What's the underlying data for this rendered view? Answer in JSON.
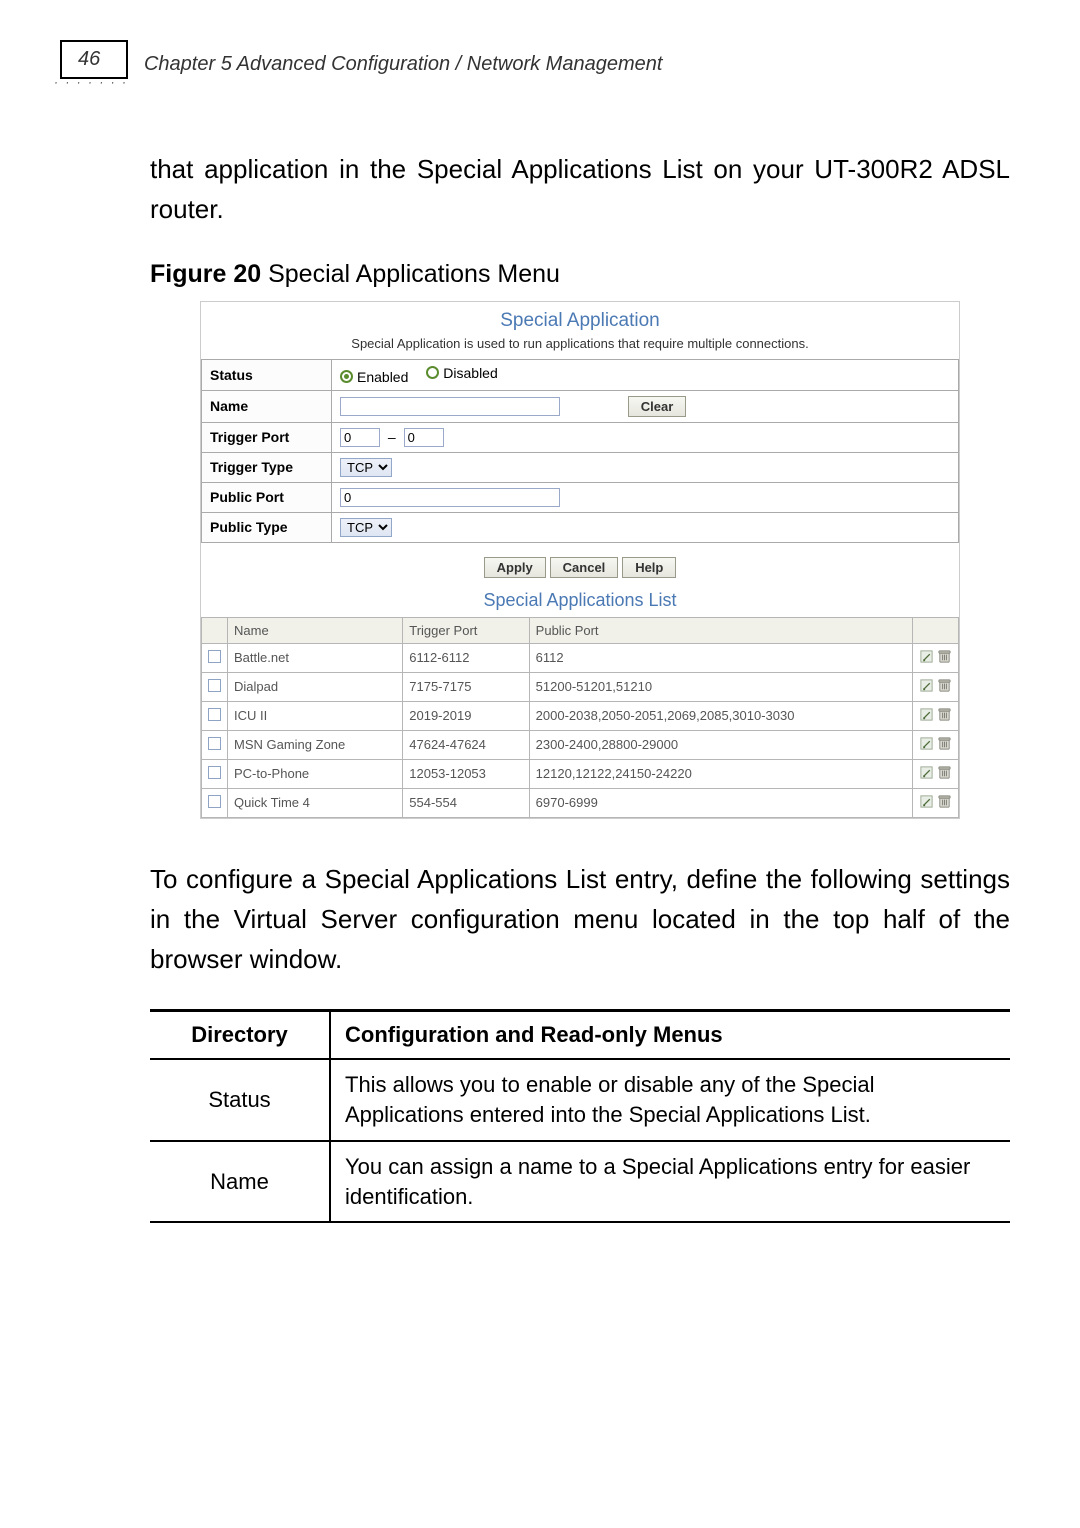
{
  "page_number": "46",
  "chapter_title": "Chapter 5 Advanced Configuration / Network Management",
  "intro_para": "that application in the Special Applications List on your UT-300R2 ADSL router.",
  "figure_label": "Figure 20",
  "figure_caption": " Special Applications Menu",
  "sa": {
    "title": "Special Application",
    "subtitle": "Special Application is used to run applications that require multiple connections.",
    "labels": {
      "status": "Status",
      "name": "Name",
      "trigger_port": "Trigger Port",
      "trigger_type": "Trigger Type",
      "public_port": "Public Port",
      "public_type": "Public Type"
    },
    "enabled": "Enabled",
    "disabled": "Disabled",
    "clear": "Clear",
    "tp_from": "0",
    "tp_to": "0",
    "dash": "–",
    "trigger_type_val": "TCP",
    "public_port_val": "0",
    "public_type_val": "TCP",
    "apply": "Apply",
    "cancel": "Cancel",
    "help": "Help"
  },
  "list": {
    "title": "Special Applications List",
    "headers": {
      "name": "Name",
      "trigger": "Trigger Port",
      "public": "Public Port"
    },
    "rows": [
      {
        "name": "Battle.net",
        "trigger": "6112-6112",
        "public": "6112"
      },
      {
        "name": "Dialpad",
        "trigger": "7175-7175",
        "public": "51200-51201,51210"
      },
      {
        "name": "ICU II",
        "trigger": "2019-2019",
        "public": "2000-2038,2050-2051,2069,2085,3010-3030"
      },
      {
        "name": "MSN Gaming Zone",
        "trigger": "47624-47624",
        "public": "2300-2400,28800-29000"
      },
      {
        "name": "PC-to-Phone",
        "trigger": "12053-12053",
        "public": "12120,12122,24150-24220"
      },
      {
        "name": "Quick Time 4",
        "trigger": "554-554",
        "public": "6970-6999"
      }
    ]
  },
  "config_para": "To configure a Special Applications List entry, define the following settings in the Virtual Server configuration menu located in the top half of the browser window.",
  "dir_headers": {
    "dir": "Directory",
    "desc": "Configuration and Read-only Menus"
  },
  "dir_rows": [
    {
      "name": "Status",
      "desc": "This allows you to enable or disable any of the Special Applications entered into the Special Applications List."
    },
    {
      "name": "Name",
      "desc": "You can assign a name to a Special Applications entry for easier identification."
    }
  ]
}
